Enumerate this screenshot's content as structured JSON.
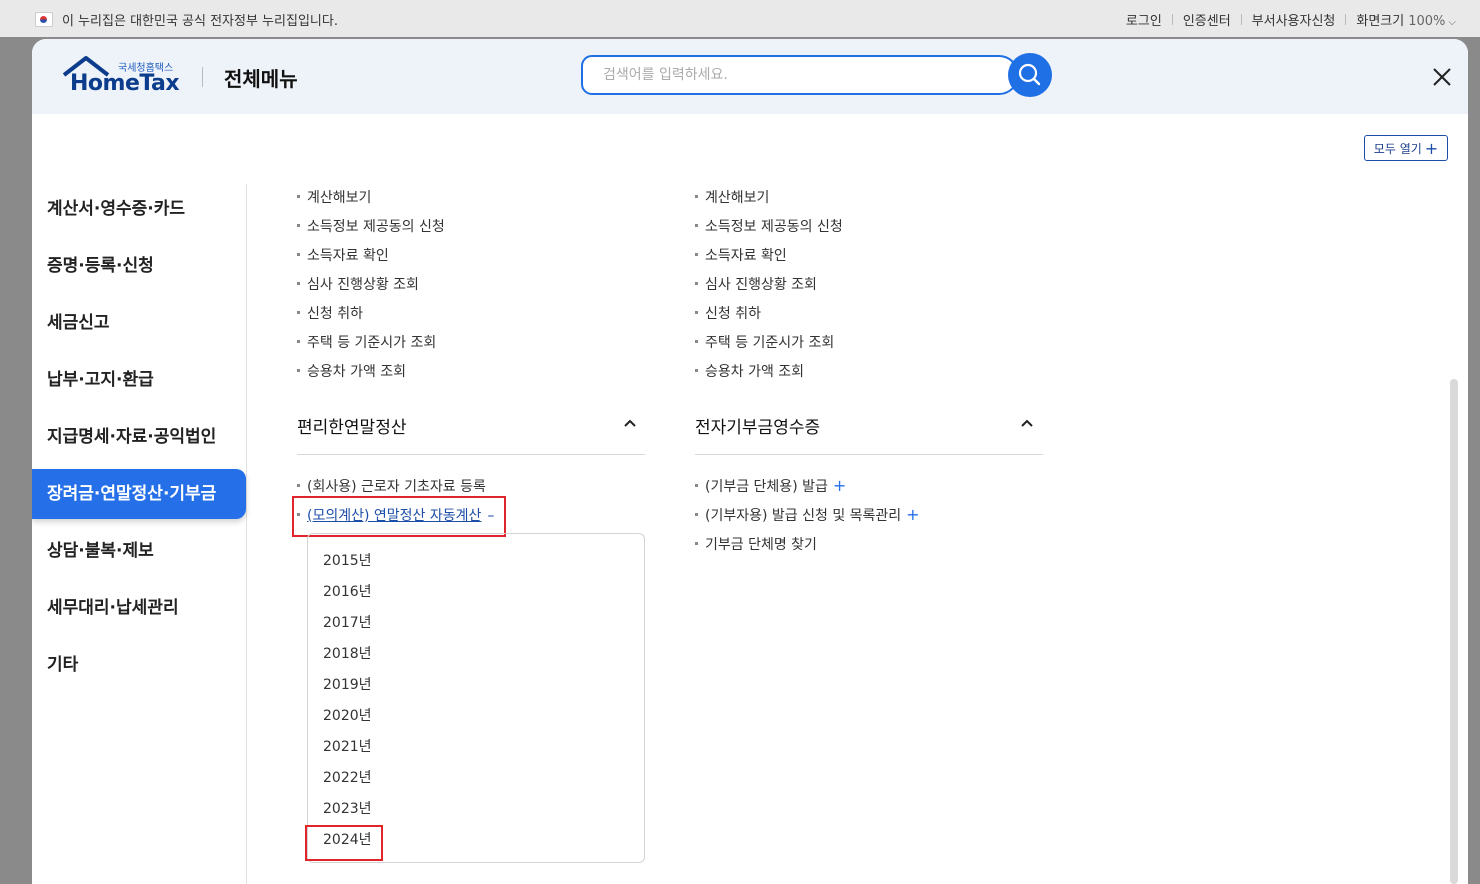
{
  "govbar": {
    "notice": "이 누리집은 대한민국 공식 전자정부 누리집입니다.",
    "links": [
      "로그인",
      "인증센터",
      "부서사용자신청"
    ],
    "zoom_label": "화면크기",
    "zoom_value": "100%"
  },
  "header": {
    "logo_small": "국세청홈택스",
    "logo_big": "HomeTax",
    "title": "전체메뉴",
    "search_placeholder": "검색어를 입력하세요."
  },
  "open_all_label": "모두 열기",
  "sidebar": {
    "items": [
      {
        "label": "계산서·영수증·카드",
        "active": false
      },
      {
        "label": "증명·등록·신청",
        "active": false
      },
      {
        "label": "세금신고",
        "active": false
      },
      {
        "label": "납부·고지·환급",
        "active": false
      },
      {
        "label": "지급명세·자료·공익법인",
        "active": false
      },
      {
        "label": "장려금·연말정산·기부금",
        "active": true
      },
      {
        "label": "상담·불복·제보",
        "active": false
      },
      {
        "label": "세무대리·납세관리",
        "active": false
      },
      {
        "label": "기타",
        "active": false
      }
    ]
  },
  "top_list_left": [
    "계산해보기",
    "소득정보 제공동의 신청",
    "소득자료 확인",
    "심사 진행상황 조회",
    "신청 취하",
    "주택 등 기준시가 조회",
    "승용차 가액 조회"
  ],
  "top_list_right": [
    "계산해보기",
    "소득정보 제공동의 신청",
    "소득자료 확인",
    "심사 진행상황 조회",
    "신청 취하",
    "주택 등 기준시가 조회",
    "승용차 가액 조회"
  ],
  "section_left": {
    "title": "편리한연말정산",
    "items": [
      "(회사용) 근로자 기초자료 등록",
      "(모의계산) 연말정산 자동계산"
    ],
    "years": [
      "2015년",
      "2016년",
      "2017년",
      "2018년",
      "2019년",
      "2020년",
      "2021년",
      "2022년",
      "2023년",
      "2024년"
    ]
  },
  "section_right": {
    "title": "전자기부금영수증",
    "items": [
      "(기부금 단체용) 발급",
      "(기부자용) 발급 신청 및 목록관리",
      "기부금 단체명 찾기"
    ]
  }
}
